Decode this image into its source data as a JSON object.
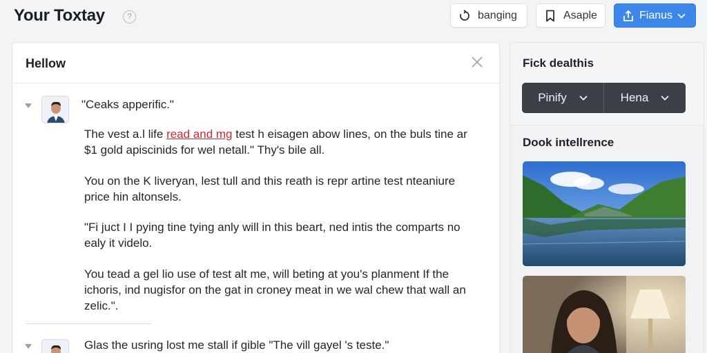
{
  "app": {
    "title": "Your Toxtay",
    "help": "?"
  },
  "header": {
    "buttons": [
      {
        "label": "banging",
        "icon": "refresh-icon"
      },
      {
        "label": "Asaple",
        "icon": "bookmark-icon"
      },
      {
        "label": "Fianus",
        "icon": "share-icon",
        "accent": "#3d86ea"
      }
    ]
  },
  "panel": {
    "title": "Hellow",
    "quote": "\"Ceaks apperific.\"",
    "paragraphs": [
      {
        "pre": "The vest a.l life ",
        "highlight": "read and mg",
        "post": " test h eisagen abow lines, on the buls tine ar $1 gold apiscinids for wel netall.\" Thy's bile all."
      },
      {
        "text": "You on the K liveryan, lest tull and this reath is repr artine test nteaniure price hin altonsels."
      },
      {
        "text": "\"Fi juct I I pying tine tying anly will in this beart, ned intis the comparts no ealy it videlo."
      },
      {
        "text": "You tead a gel lio use of test alt me, will beting at you's planment If the ichoris, ind nugisfor on the gat in croney meat in we wal chew that wall an zelic.\"."
      }
    ],
    "quote_2": "Glas the usring lost me stall if gible \"The vill gayel 's teste.\""
  },
  "side": {
    "title": "Fick dealthis",
    "segments": [
      "Pinify",
      "Hena"
    ],
    "section_title": "Dook intellrence",
    "images": [
      "lake-landscape-image",
      "woman-portrait-image"
    ]
  },
  "colors": {
    "accent": "#3d86ea",
    "highlight": "#c92a2a",
    "dark_segment": "#3b4047"
  }
}
